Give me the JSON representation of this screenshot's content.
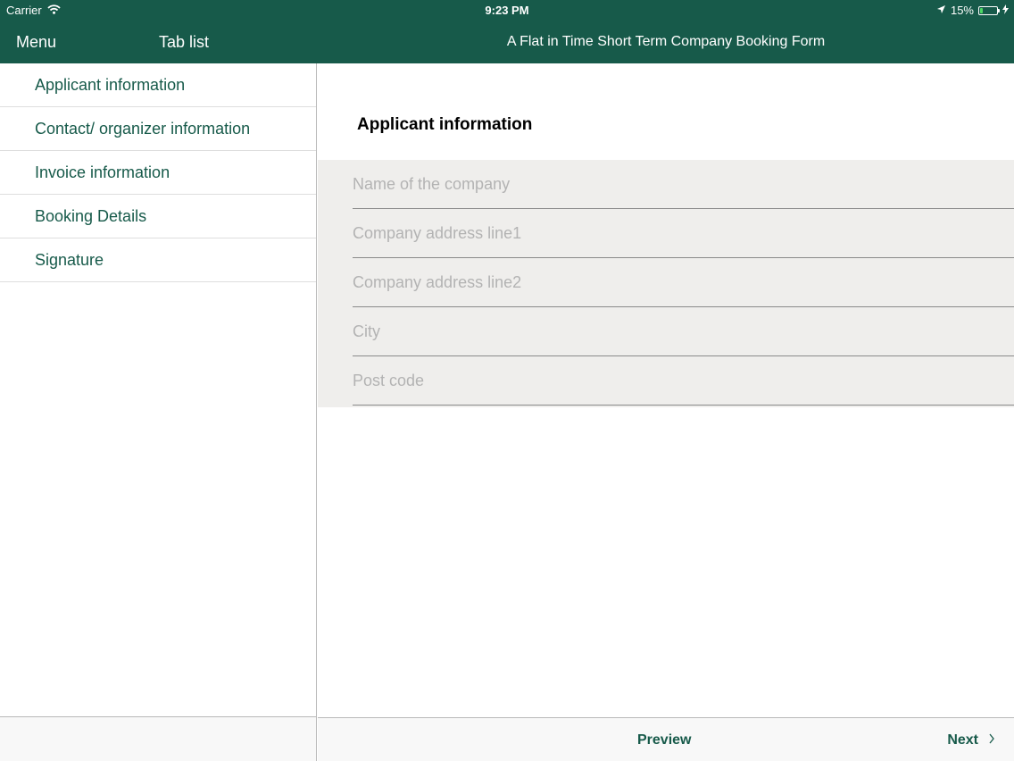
{
  "status_bar": {
    "carrier": "Carrier",
    "time": "9:23 PM",
    "battery_percent": "15%",
    "battery_level": 0.15,
    "icons": [
      "wifi-icon",
      "location-arrow-icon",
      "battery-icon",
      "charging-bolt-icon"
    ]
  },
  "nav": {
    "menu_label": "Menu",
    "tab_list_label": "Tab list",
    "title": "A Flat in Time Short Term Company Booking Form"
  },
  "sidebar": {
    "items": [
      {
        "label": "Applicant information"
      },
      {
        "label": "Contact/ organizer information"
      },
      {
        "label": "Invoice information"
      },
      {
        "label": "Booking Details"
      },
      {
        "label": "Signature"
      }
    ]
  },
  "main": {
    "section_title": "Applicant information",
    "fields": [
      {
        "placeholder": "Name of the company",
        "value": ""
      },
      {
        "placeholder": "Company address line1",
        "value": ""
      },
      {
        "placeholder": "Company address line2",
        "value": ""
      },
      {
        "placeholder": "City",
        "value": ""
      },
      {
        "placeholder": "Post code",
        "value": ""
      }
    ]
  },
  "footer": {
    "preview_label": "Preview",
    "next_label": "Next",
    "next_icon": "chevron-right-icon"
  },
  "colors": {
    "brand": "#175a4a",
    "form_background": "#efeeec",
    "placeholder": "#b3b3b3",
    "battery_fill": "#4cd964"
  }
}
